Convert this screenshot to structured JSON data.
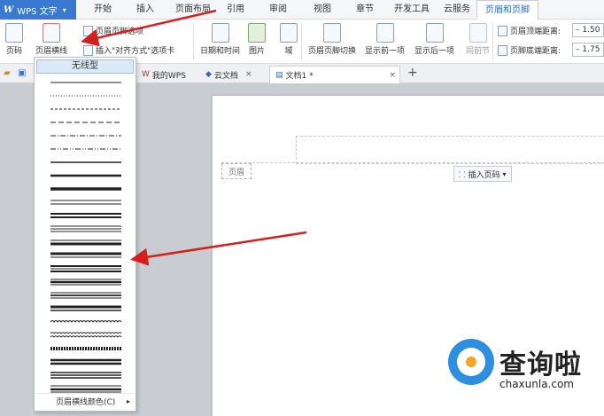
{
  "app": {
    "title": "WPS 文字",
    "logo": "W"
  },
  "menu": {
    "tabs": [
      "开始",
      "插入",
      "页面布局",
      "引用",
      "审阅",
      "视图",
      "章节",
      "开发工具",
      "云服务",
      "页眉和页脚"
    ],
    "active": "页眉和页脚"
  },
  "ribbon": {
    "page_number": "页码",
    "header_line": "页眉横线",
    "header_footer_options": "页眉页脚选项",
    "insert_align_tab": "插入\"对齐方式\"选项卡",
    "date_time": "日期和时间",
    "picture": "图片",
    "field": "域",
    "switch_header_footer": "页眉页脚切换",
    "show_prev": "显示前一项",
    "show_next": "显示后一项",
    "same_as_prev": "同前节",
    "header_top_distance_label": "页眉顶端距离:",
    "header_top_distance_value": "1.50",
    "footer_bottom_distance_label": "页脚底端距离:",
    "footer_bottom_distance_value": "1.75"
  },
  "tabbar": {
    "tabs": [
      {
        "label": "我的WPS",
        "icon": "wps-icon"
      },
      {
        "label": "云文档",
        "icon": "cloud-icon"
      },
      {
        "label": "文档1 *",
        "icon": "document-icon"
      }
    ],
    "active_index": 2,
    "close_glyph": "×",
    "add_glyph": "+"
  },
  "dropdown": {
    "none_label": "无线型",
    "color_label": "页眉横线颜色(C)",
    "line_styles": [
      "solid-thin",
      "dotted",
      "dashed",
      "dashed-long",
      "dash-dot",
      "dash-dot-dot",
      "solid",
      "solid-medium",
      "thick",
      "double",
      "double-thick",
      "triple",
      "thin-thick",
      "thick-thin",
      "thick-thin-thick",
      "thin-thick-thin",
      "thin-medium-thin",
      "thick-medium",
      "wave",
      "double-wave",
      "hatched",
      "thick-double",
      "triple-thick",
      "thin-thick-thin-large"
    ]
  },
  "document": {
    "header_tag": "页眉",
    "insert_page_number": "插入页码"
  },
  "watermark": {
    "title": "查询啦",
    "site": "chaxunla.com"
  },
  "colors": {
    "accent": "#3a79d1",
    "arrow": "#d61f1f",
    "selected": "#dce9f8"
  }
}
